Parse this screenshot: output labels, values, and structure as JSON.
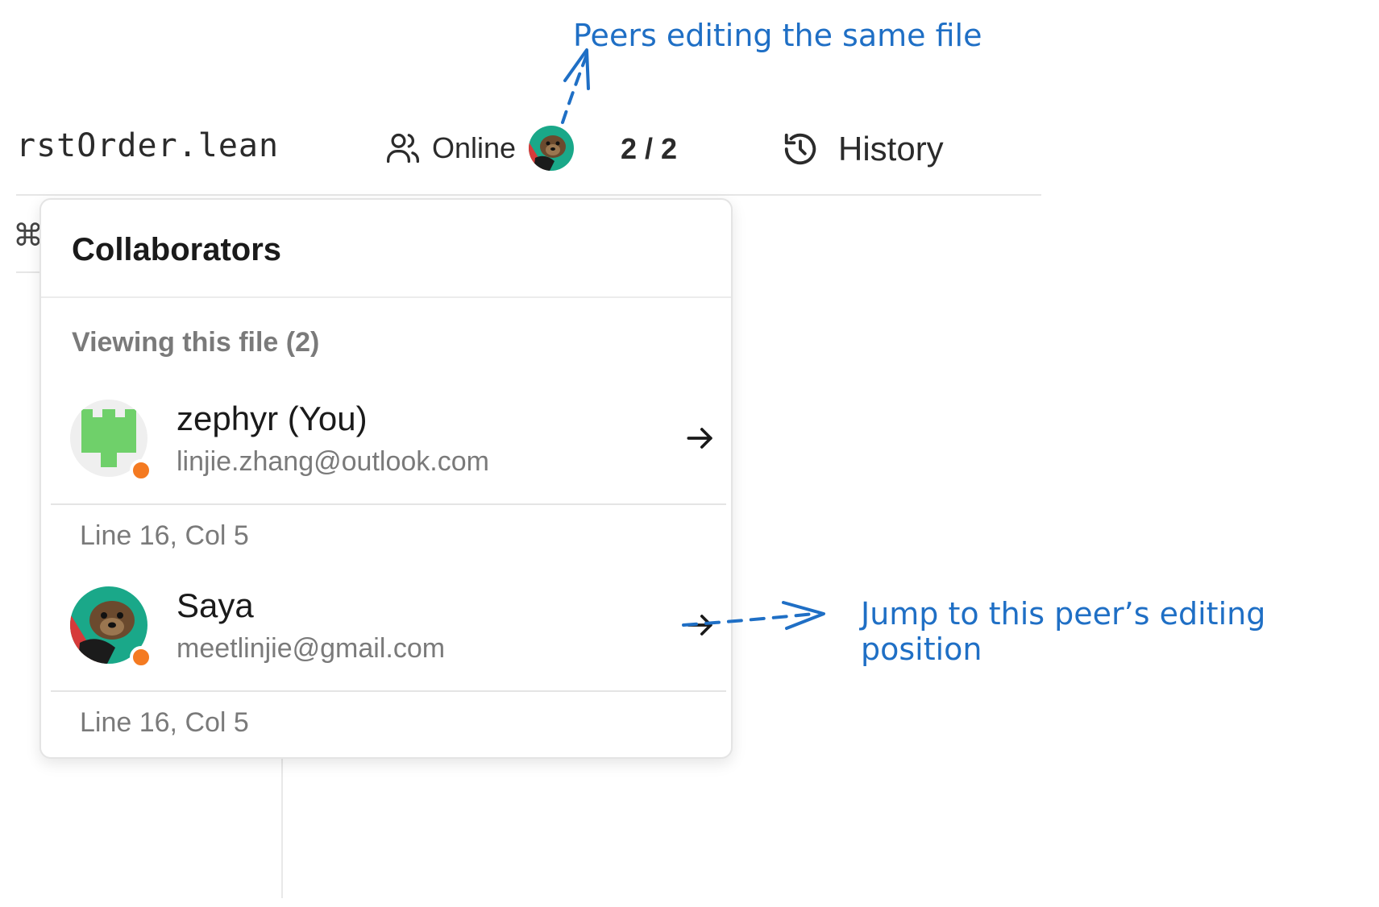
{
  "header": {
    "filename": "rstOrder.lean",
    "online_label": "Online",
    "peer_count": "2 / 2",
    "history_label": "History",
    "icons": [
      "users-icon",
      "history-icon"
    ]
  },
  "gutter": {
    "glyph": "⌘"
  },
  "collaborators": {
    "title": "Collaborators",
    "section_label": "Viewing this file (2)",
    "status_color": "#f47a21",
    "people": [
      {
        "name": "zephyr (You)",
        "email": "linjie.zhang@outlook.com",
        "position": "Line 16, Col 5",
        "avatar": "green-castle-avatar"
      },
      {
        "name": "Saya",
        "email": "meetlinjie@gmail.com",
        "position": "Line 16, Col 5",
        "avatar": "sea-otter-photo-avatar"
      }
    ]
  },
  "annotations": {
    "top": "Peers editing the same file",
    "right": "Jump to this peer’s editing position",
    "color": "#1f6fc5"
  }
}
